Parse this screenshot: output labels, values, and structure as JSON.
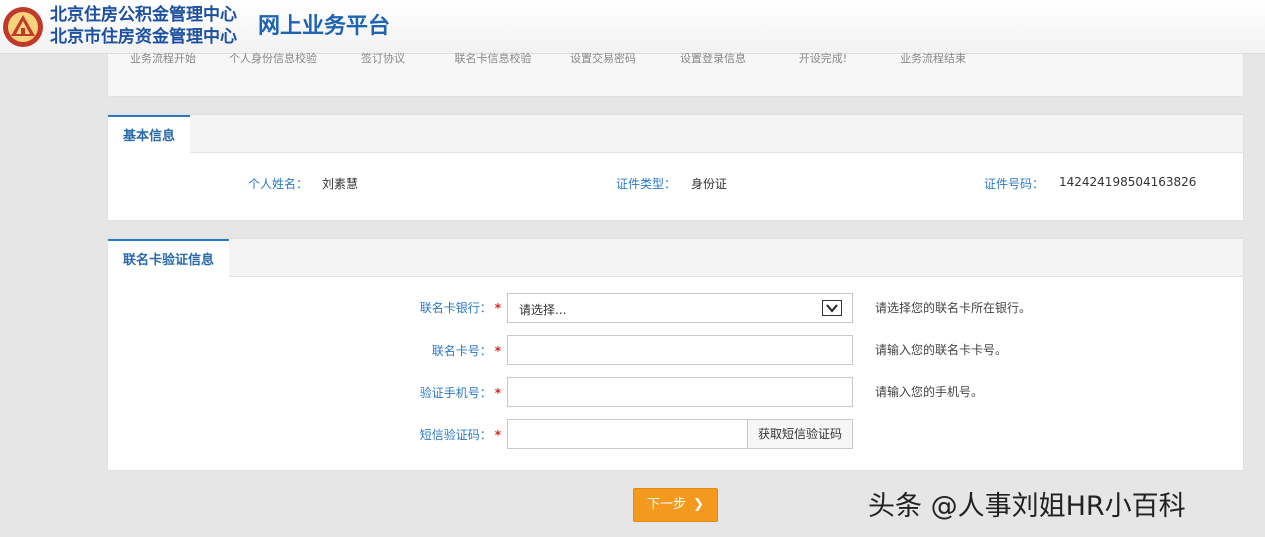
{
  "header": {
    "org_line1": "北京住房公积金管理中心",
    "org_line2": "北京市住房资金管理中心",
    "platform": "网上业务平台"
  },
  "steps": [
    "业务流程开始",
    "个人身份信息校验",
    "签订协议",
    "联名卡信息校验",
    "设置交易密码",
    "设置登录信息",
    "开设完成!",
    "业务流程结束"
  ],
  "basic_info": {
    "title": "基本信息",
    "name_label": "个人姓名：",
    "name_value": "刘素慧",
    "id_type_label": "证件类型：",
    "id_type_value": "身份证",
    "id_no_label": "证件号码：",
    "id_no_value": "142424198504163826"
  },
  "card_verify": {
    "title": "联名卡验证信息",
    "bank_label": "联名卡银行：",
    "bank_value": "请选择...",
    "bank_hint": "请选择您的联名卡所在银行。",
    "card_no_label": "联名卡号：",
    "card_no_value": "",
    "card_no_hint": "请输入您的联名卡卡号。",
    "phone_label": "验证手机号：",
    "phone_value": "",
    "phone_hint": "请输入您的手机号。",
    "sms_label": "短信验证码：",
    "sms_value": "",
    "sms_button": "获取短信验证码",
    "required_mark": "*"
  },
  "next_button": "下一步",
  "watermark": "头条 @人事刘姐HR小百科",
  "colors": {
    "accent_blue": "#2a79c4",
    "button_orange": "#f39a1e",
    "required_red": "#e02020"
  }
}
